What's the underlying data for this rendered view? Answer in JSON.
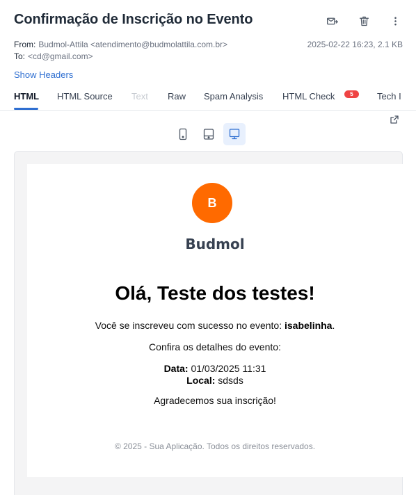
{
  "email": {
    "subject": "Confirmação de Inscrição no Evento",
    "from_label": "From:",
    "from_value": "Budmol-Attila <atendimento@budmolattila.com.br>",
    "to_label": "To:",
    "to_value": "<cd@gmail.com>",
    "date_size": "2025-02-22 16:23, 2.1 KB",
    "show_headers": "Show Headers"
  },
  "actions": {
    "icons": [
      "forward-icon",
      "trash-icon",
      "more-vertical-icon"
    ]
  },
  "tabs": [
    {
      "label": "HTML",
      "state": "active"
    },
    {
      "label": "HTML Source",
      "state": "normal"
    },
    {
      "label": "Text",
      "state": "disabled"
    },
    {
      "label": "Raw",
      "state": "normal"
    },
    {
      "label": "Spam Analysis",
      "state": "normal"
    },
    {
      "label": "HTML Check",
      "state": "normal",
      "badge": "5"
    },
    {
      "label": "Tech I",
      "state": "normal"
    }
  ],
  "devices": {
    "options": [
      "mobile",
      "tablet",
      "desktop"
    ],
    "selected": "desktop"
  },
  "colors": {
    "accent": "#2f6fd1",
    "badge": "#ef4444",
    "logo": "#ff6a00"
  },
  "message": {
    "logo_letter": "B",
    "brand": "Budmol",
    "greeting": "Olá, Teste dos testes!",
    "line1_prefix": "Você se inscreveu com sucesso no evento: ",
    "event_name": "isabelinha",
    "line1_suffix": ".",
    "line2": "Confira os detalhes do evento:",
    "date_label": "Data:",
    "date_value": " 01/03/2025 11:31",
    "local_label": "Local:",
    "local_value": " sdsds",
    "thanks": "Agradecemos sua inscrição!",
    "footer": "© 2025 - Sua Aplicação. Todos os direitos reservados."
  }
}
